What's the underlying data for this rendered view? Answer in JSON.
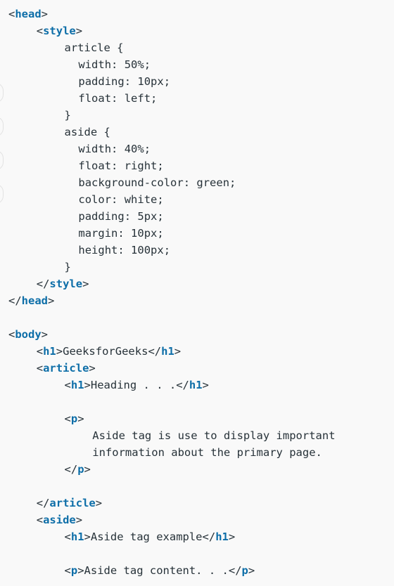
{
  "code": {
    "lines": [
      {
        "indent": 1,
        "parts": [
          {
            "t": "<",
            "k": "bracket"
          },
          {
            "t": "head",
            "k": "tag"
          },
          {
            "t": ">",
            "k": "bracket"
          }
        ]
      },
      {
        "indent": 5,
        "parts": [
          {
            "t": "<",
            "k": "bracket"
          },
          {
            "t": "style",
            "k": "tag"
          },
          {
            "t": ">",
            "k": "bracket"
          }
        ]
      },
      {
        "indent": 9,
        "parts": [
          {
            "t": "article {",
            "k": "text"
          }
        ]
      },
      {
        "indent": 11,
        "parts": [
          {
            "t": "width: 50%;",
            "k": "text"
          }
        ]
      },
      {
        "indent": 11,
        "parts": [
          {
            "t": "padding: 10px;",
            "k": "text"
          }
        ]
      },
      {
        "indent": 11,
        "parts": [
          {
            "t": "float: left;",
            "k": "text"
          }
        ]
      },
      {
        "indent": 9,
        "parts": [
          {
            "t": "}",
            "k": "text"
          }
        ]
      },
      {
        "indent": 9,
        "parts": [
          {
            "t": "aside {",
            "k": "text"
          }
        ]
      },
      {
        "indent": 11,
        "parts": [
          {
            "t": "width: 40%;",
            "k": "text"
          }
        ]
      },
      {
        "indent": 11,
        "parts": [
          {
            "t": "float: right;",
            "k": "text"
          }
        ]
      },
      {
        "indent": 11,
        "parts": [
          {
            "t": "background-color: green;",
            "k": "text"
          }
        ]
      },
      {
        "indent": 11,
        "parts": [
          {
            "t": "color: white;",
            "k": "text"
          }
        ]
      },
      {
        "indent": 11,
        "parts": [
          {
            "t": "padding: 5px;",
            "k": "text"
          }
        ]
      },
      {
        "indent": 11,
        "parts": [
          {
            "t": "margin: 10px;",
            "k": "text"
          }
        ]
      },
      {
        "indent": 11,
        "parts": [
          {
            "t": "height: 100px;",
            "k": "text"
          }
        ]
      },
      {
        "indent": 9,
        "parts": [
          {
            "t": "}",
            "k": "text"
          }
        ]
      },
      {
        "indent": 5,
        "parts": [
          {
            "t": "</",
            "k": "bracket"
          },
          {
            "t": "style",
            "k": "tag"
          },
          {
            "t": ">",
            "k": "bracket"
          }
        ]
      },
      {
        "indent": 1,
        "parts": [
          {
            "t": "</",
            "k": "bracket"
          },
          {
            "t": "head",
            "k": "tag"
          },
          {
            "t": ">",
            "k": "bracket"
          }
        ]
      },
      {
        "indent": 1,
        "parts": []
      },
      {
        "indent": 1,
        "parts": [
          {
            "t": "<",
            "k": "bracket"
          },
          {
            "t": "body",
            "k": "tag"
          },
          {
            "t": ">",
            "k": "bracket"
          }
        ]
      },
      {
        "indent": 5,
        "parts": [
          {
            "t": "<",
            "k": "bracket"
          },
          {
            "t": "h1",
            "k": "tag"
          },
          {
            "t": ">",
            "k": "bracket"
          },
          {
            "t": "GeeksforGeeks",
            "k": "text"
          },
          {
            "t": "</",
            "k": "bracket"
          },
          {
            "t": "h1",
            "k": "tag"
          },
          {
            "t": ">",
            "k": "bracket"
          }
        ]
      },
      {
        "indent": 5,
        "parts": [
          {
            "t": "<",
            "k": "bracket"
          },
          {
            "t": "article",
            "k": "tag"
          },
          {
            "t": ">",
            "k": "bracket"
          }
        ]
      },
      {
        "indent": 9,
        "parts": [
          {
            "t": "<",
            "k": "bracket"
          },
          {
            "t": "h1",
            "k": "tag"
          },
          {
            "t": ">",
            "k": "bracket"
          },
          {
            "t": "Heading . . .",
            "k": "text"
          },
          {
            "t": "</",
            "k": "bracket"
          },
          {
            "t": "h1",
            "k": "tag"
          },
          {
            "t": ">",
            "k": "bracket"
          }
        ]
      },
      {
        "indent": 1,
        "parts": []
      },
      {
        "indent": 9,
        "parts": [
          {
            "t": "<",
            "k": "bracket"
          },
          {
            "t": "p",
            "k": "tag"
          },
          {
            "t": ">",
            "k": "bracket"
          }
        ]
      },
      {
        "indent": 13,
        "parts": [
          {
            "t": "Aside tag is use to display important",
            "k": "text"
          }
        ]
      },
      {
        "indent": 13,
        "parts": [
          {
            "t": "information about the primary page.",
            "k": "text"
          }
        ]
      },
      {
        "indent": 9,
        "parts": [
          {
            "t": "</",
            "k": "bracket"
          },
          {
            "t": "p",
            "k": "tag"
          },
          {
            "t": ">",
            "k": "bracket"
          }
        ]
      },
      {
        "indent": 1,
        "parts": []
      },
      {
        "indent": 5,
        "parts": [
          {
            "t": "</",
            "k": "bracket"
          },
          {
            "t": "article",
            "k": "tag"
          },
          {
            "t": ">",
            "k": "bracket"
          }
        ]
      },
      {
        "indent": 5,
        "parts": [
          {
            "t": "<",
            "k": "bracket"
          },
          {
            "t": "aside",
            "k": "tag"
          },
          {
            "t": ">",
            "k": "bracket"
          }
        ]
      },
      {
        "indent": 9,
        "parts": [
          {
            "t": "<",
            "k": "bracket"
          },
          {
            "t": "h1",
            "k": "tag"
          },
          {
            "t": ">",
            "k": "bracket"
          },
          {
            "t": "Aside tag example",
            "k": "text"
          },
          {
            "t": "</",
            "k": "bracket"
          },
          {
            "t": "h1",
            "k": "tag"
          },
          {
            "t": ">",
            "k": "bracket"
          }
        ]
      },
      {
        "indent": 1,
        "parts": []
      },
      {
        "indent": 9,
        "parts": [
          {
            "t": "<",
            "k": "bracket"
          },
          {
            "t": "p",
            "k": "tag"
          },
          {
            "t": ">",
            "k": "bracket"
          },
          {
            "t": "Aside tag content. . .",
            "k": "text"
          },
          {
            "t": "</",
            "k": "bracket"
          },
          {
            "t": "p",
            "k": "tag"
          },
          {
            "t": ">",
            "k": "bracket"
          }
        ]
      }
    ]
  },
  "colors": {
    "background": "#f9f9f9",
    "tag": "#0d6ea8",
    "text": "#273239"
  }
}
